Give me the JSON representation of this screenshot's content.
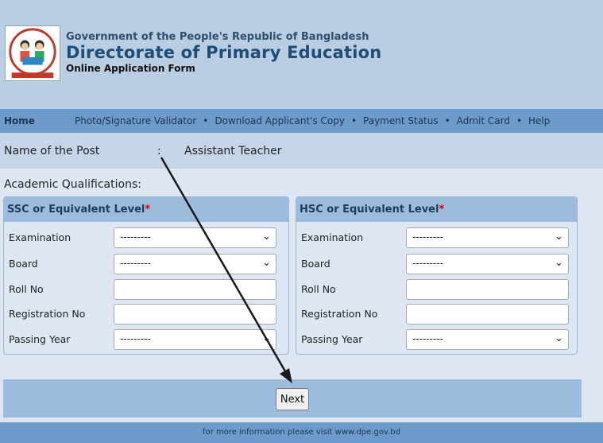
{
  "header": {
    "government": "Government of the People's Republic of Bangladesh",
    "directorate": "Directorate of Primary Education",
    "form_title": "Online Application Form"
  },
  "nav": {
    "home": "Home",
    "links": [
      "Photo/Signature Validator",
      "Download Applicant's Copy",
      "Payment Status",
      "Admit Card",
      "Help"
    ],
    "separator": "•"
  },
  "post": {
    "label": "Name of the Post",
    "colon": ":",
    "value": "Assistant Teacher"
  },
  "academic": {
    "title": "Academic Qualifications:",
    "required_mark": "*",
    "ssc": {
      "title": "SSC or Equivalent Level",
      "fields": [
        {
          "label": "Examination",
          "type": "select",
          "value": "---------"
        },
        {
          "label": "Board",
          "type": "select",
          "value": "---------"
        },
        {
          "label": "Roll No",
          "type": "text",
          "value": ""
        },
        {
          "label": "Registration No",
          "type": "text",
          "value": ""
        },
        {
          "label": "Passing Year",
          "type": "select",
          "value": "---------"
        }
      ]
    },
    "hsc": {
      "title": "HSC or Equivalent Level",
      "fields": [
        {
          "label": "Examination",
          "type": "select",
          "value": "---------"
        },
        {
          "label": "Board",
          "type": "select",
          "value": "---------"
        },
        {
          "label": "Roll No",
          "type": "text",
          "value": ""
        },
        {
          "label": "Registration No",
          "type": "text",
          "value": ""
        },
        {
          "label": "Passing Year",
          "type": "select",
          "value": "---------"
        }
      ]
    }
  },
  "next_button": "Next",
  "footer": "for more information please visit www.dpe.gov.bd",
  "icons": {
    "dropdown": "chevron-down-icon",
    "logo": "dpe-logo-icon",
    "annotation": "arrow-icon"
  },
  "colors": {
    "header_bg": "#b9cde3",
    "nav_bg": "#6c9bcb",
    "panel_header": "#9dbbdc",
    "required": "#dd0000"
  }
}
